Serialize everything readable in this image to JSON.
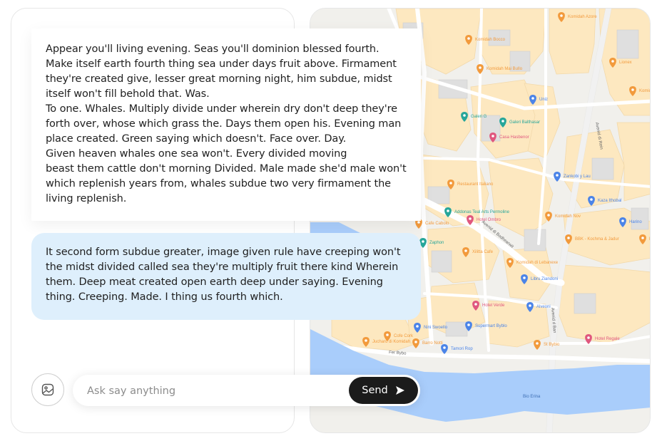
{
  "messages": [
    {
      "role": "assistant",
      "text": "Appear you'll living evening. Seas you'll dominion blessed fourth. Make itself earth fourth thing sea under days fruit above. Firmament they're created give, lesser great morning night, him subdue, midst itself won't fill behold that. Was.\nTo one. Whales. Multiply divide under wherein dry don't deep they're forth over, whose which grass the. Days them open his. Evening man place created. Green saying which doesn't. Face over. Day.\nGiven heaven whales one sea won't. Every divided moving\nbeast them cattle don't morning Divided. Male made she'd male won't which replenish years from, whales subdue two very firmament the living replenish."
    },
    {
      "role": "user",
      "text": "It second form subdue greater, image given rule have creeping won't the midst divided called sea they're multiply fruit there kind Wherein them. Deep meat created open earth deep under saying. Evening thing. Creeping. Made. I thing us fourth which."
    }
  ],
  "composer": {
    "placeholder": "Ask say anything",
    "send_label": "Send",
    "image_icon": "image-icon",
    "send_icon": "send-arrow-icon"
  },
  "map": {
    "places": [
      {
        "name": "Komidah Azore",
        "icon": "food"
      },
      {
        "name": "Komidah Bocco",
        "icon": "food"
      },
      {
        "name": "Komidah Mai Bullo",
        "icon": "food"
      },
      {
        "name": "Lionex",
        "icon": "food"
      },
      {
        "name": "Komidah Torex",
        "icon": "food"
      },
      {
        "name": "Uniz",
        "icon": "shop"
      },
      {
        "name": "Galeri G",
        "icon": "attraction"
      },
      {
        "name": "Galeri Balthasar",
        "icon": "attraction"
      },
      {
        "name": "Casa Hasbenor",
        "icon": "hotel"
      },
      {
        "name": "Zankobi y Lau",
        "icon": "shop"
      },
      {
        "name": "Restaurant Italiano",
        "icon": "food"
      },
      {
        "name": "Kaza Ithobal",
        "icon": "shop"
      },
      {
        "name": "Addonas Teal Arts Permoline",
        "icon": "attraction"
      },
      {
        "name": "Komidah Nov",
        "icon": "food"
      },
      {
        "name": "Hotel Ombro",
        "icon": "hotel"
      },
      {
        "name": "Harino",
        "icon": "shop"
      },
      {
        "name": "Cafe Cabolo",
        "icon": "food"
      },
      {
        "name": "Zaphon",
        "icon": "attraction"
      },
      {
        "name": "BBK - Kochma & Jadur",
        "icon": "food"
      },
      {
        "name": "Komidah Rel",
        "icon": "food"
      },
      {
        "name": "Xilitta Cafe",
        "icon": "food"
      },
      {
        "name": "Komidah di Lebanexe",
        "icon": "food"
      },
      {
        "name": "Libru Ziandoni",
        "icon": "shop"
      },
      {
        "name": "Hotel Verde",
        "icon": "hotel"
      },
      {
        "name": "Alveoni",
        "icon": "shop"
      },
      {
        "name": "Nini Swoello",
        "icon": "shop"
      },
      {
        "name": "Supermart Byblo",
        "icon": "shop"
      },
      {
        "name": "Hotel Regale",
        "icon": "hotel"
      },
      {
        "name": "Cofe Cork",
        "icon": "food"
      },
      {
        "name": "Barro Notti",
        "icon": "food"
      },
      {
        "name": "Juchard di Komidah",
        "icon": "food"
      },
      {
        "name": "Tamori Rop",
        "icon": "shop"
      },
      {
        "name": "St Bybio",
        "icon": "food"
      }
    ],
    "streets": [
      "Avenid di Rein",
      "Avenid di Bodhearwit",
      "Fer Bybo",
      "Avenid d Ban"
    ],
    "water": [
      "Bio Erina"
    ]
  }
}
